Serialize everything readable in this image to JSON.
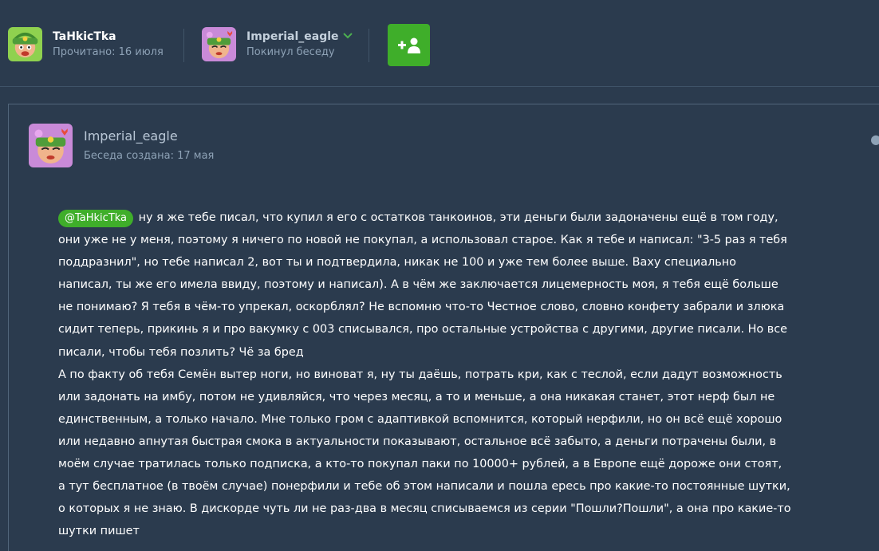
{
  "header": {
    "participants": [
      {
        "name": "TaHkicTka",
        "status": "Прочитано: 16 июля"
      },
      {
        "name": "Imperial_eagle",
        "status": "Покинул беседу"
      }
    ],
    "add_button_icon": "add-user-icon"
  },
  "post": {
    "author": "Imperial_eagle",
    "created": "Беседа создана: 17 мая",
    "menu_icon": "more-icon",
    "mention": "@TaHkicTka",
    "paragraphs": [
      "ну я же тебе писал, что купил я его с остатков танкоинов, эти деньги были задоначены ещё в том году, они уже не у меня, поэтому я ничего по новой не покупал, а использовал старое. Как я тебе и написал: \"3-5 раз я тебя поддразнил\", но тебе написал 2, вот ты и подтвердила, никак не 100 и уже тем более выше. Ваху специально написал, ты же его имела ввиду, поэтому и написал). А в чём же заключается лицемерность моя, я тебя ещё больше не понимаю? Я тебя в чём-то упрекал, оскорблял? Не вспомню что-то Честное слово, словно конфету забрали и злюка сидит теперь, прикинь я и про вакумку с 003 списывался, про остальные устройства с другими, другие писали. Но все писали, чтобы тебя позлить? Чё за бред",
      "А по факту об тебя Семён вытер ноги, но виноват я, ну ты даёшь, потрать  кри, как с теслой, если дадут возможность или задонать на имбу, потом не удивляйся, что через месяц, а то и меньше, а она никакая станет, этот нерф был не единственным, а только начало. Мне только гром с адаптивкой вспомнится, который нерфили, но он всё ещё хорошо или недавно апнутая быстрая смока в актуальности показывают, остальное всё забыто, а деньги потрачены были, в моём случае тратилась только подписка, а кто-то покупал паки по 10000+ рублей, а в Европе ещё дороже они стоят, а тут бесплатное (в твоём случае) понерфили и тебе об этом написали и пошла ересь про какие-то постоянные шутки, о которых я не знаю. В дискорде чуть ли не раз-два в месяц списываемся из серии \"Пошли?Пошли\", а она про какие-то шутки пишет"
    ]
  },
  "colors": {
    "background": "#2b3b4e",
    "accent_green": "#3fae2a",
    "muted_text": "#8ea2b6"
  }
}
